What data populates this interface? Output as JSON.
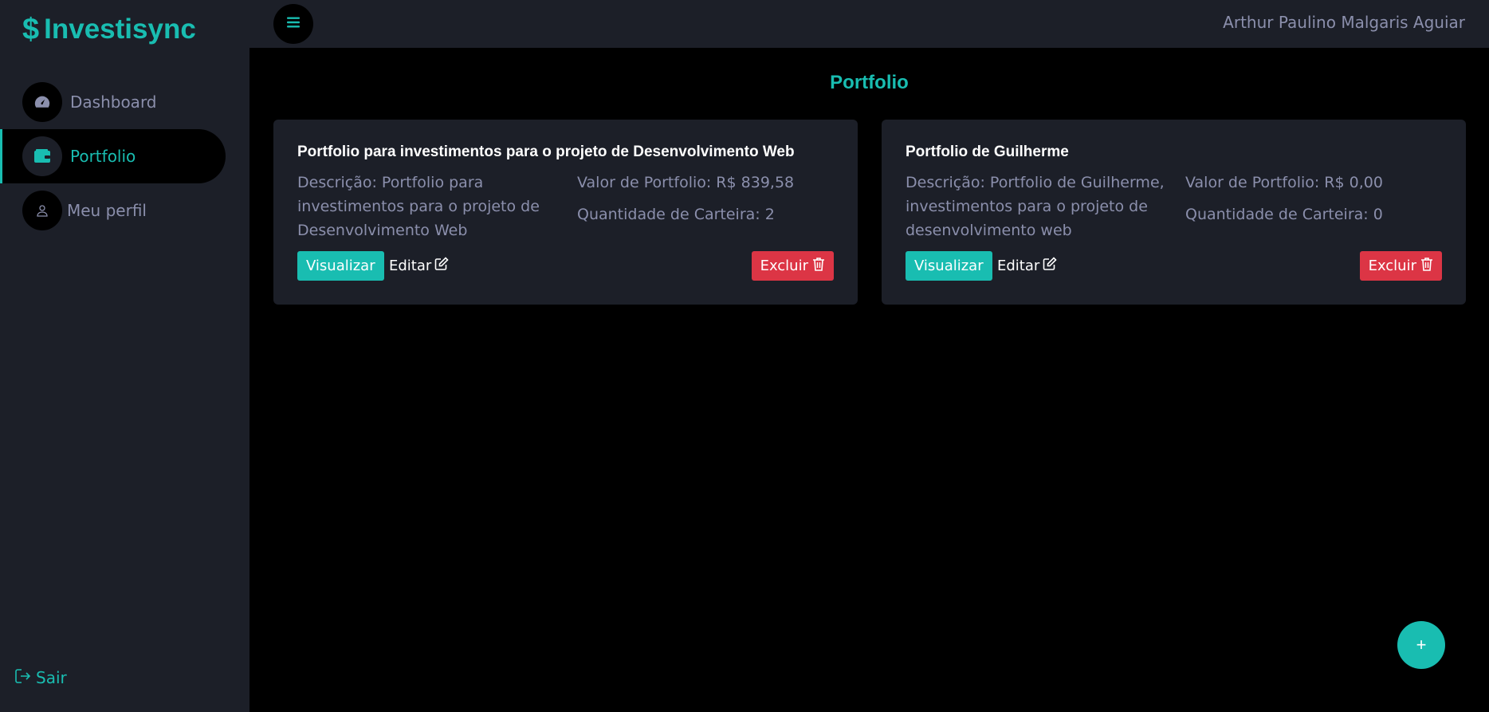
{
  "brand": {
    "symbol": "$",
    "name": "Investisync",
    "accent_color": "#19bdb1"
  },
  "sidebar": {
    "items": [
      {
        "label": "Dashboard",
        "icon": "speedometer-icon",
        "active": false
      },
      {
        "label": "Portfolio",
        "icon": "wallet-icon",
        "active": true
      },
      {
        "label": "Meu perfil",
        "icon": "user-icon",
        "active": false
      }
    ],
    "logout_label": "Sair"
  },
  "topbar": {
    "menu_icon": "hamburger-icon",
    "user_name": "Arthur Paulino Malgaris Aguiar"
  },
  "main": {
    "title": "Portfolio",
    "cards": [
      {
        "title": "Portfolio para investimentos para o projeto de Desenvolvimento Web",
        "description": "Descrição: Portfolio para investimentos para o projeto de Desenvolvimento Web",
        "value": "Valor de Portfolio: R$ 839,58",
        "wallets": "Quantidade de Carteira: 2",
        "view_label": "Visualizar",
        "edit_label": "Editar",
        "delete_label": "Excluir"
      },
      {
        "title": "Portfolio de Guilherme",
        "description": "Descrição: Portfolio de Guilherme, investimentos para o projeto de desenvolvimento web",
        "value": "Valor de Portfolio: R$ 0,00",
        "wallets": "Quantidade de Carteira: 0",
        "view_label": "Visualizar",
        "edit_label": "Editar",
        "delete_label": "Excluir"
      }
    ],
    "add_button_label": "+"
  },
  "colors": {
    "sidebar_bg": "#1c1f28",
    "main_bg": "#000000",
    "muted_text": "#8b8fac",
    "danger": "#dc3545"
  }
}
